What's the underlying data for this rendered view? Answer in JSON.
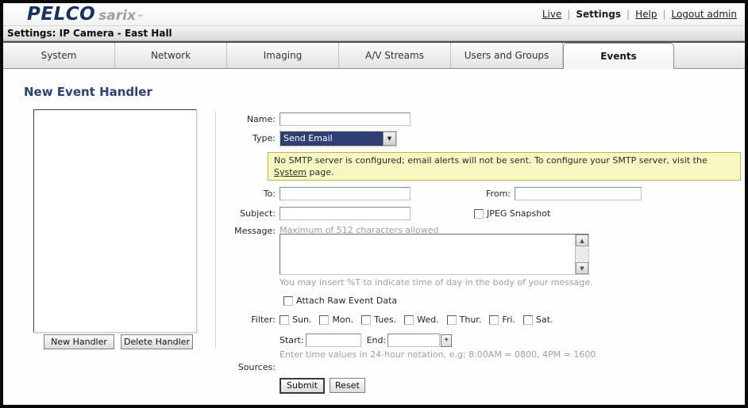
{
  "header": {
    "brand": "PELCO",
    "product": "sarix",
    "trademark": "™",
    "nav": {
      "live": "Live",
      "settings": "Settings",
      "help": "Help",
      "logout": "Logout admin",
      "separator": "|"
    }
  },
  "settings_bar": {
    "title": "Settings: IP Camera - East Hall"
  },
  "tabs": [
    {
      "label": "System"
    },
    {
      "label": "Network"
    },
    {
      "label": "Imaging"
    },
    {
      "label": "A/V Streams"
    },
    {
      "label": "Users and Groups"
    },
    {
      "label": "Events",
      "active": true
    }
  ],
  "content": {
    "title": "New Event Handler",
    "handler_panel": {
      "new_button": "New Handler",
      "delete_button": "Delete Handler"
    },
    "form": {
      "name_label": "Name:",
      "type_label": "Type:",
      "type_value": "Send Email",
      "dropdown_arrow": "▼",
      "warning": {
        "before": "No SMTP server is configured; email alerts will not be sent. To configure your SMTP server, visit the ",
        "link": "System",
        "after": " page."
      },
      "to_label": "To:",
      "from_label": "From:",
      "subject_label": "Subject:",
      "jpeg_label": "JPEG Snapshot",
      "message_label": "Message:",
      "message_hint": "Maximum of 512 characters allowed",
      "message_footnote": "You may insert %T to indicate time of day in the body of your message.",
      "scroll_up": "▲",
      "scroll_down": "▼",
      "attach_label": "Attach Raw Event Data",
      "filter_label": "Filter:",
      "days": [
        "Sun.",
        "Mon.",
        "Tues.",
        "Wed.",
        "Thur.",
        "Fri.",
        "Sat."
      ],
      "start_label": "Start:",
      "end_label": "End:",
      "add_button": "+",
      "time_hint": "Enter time values in 24-hour notation, e.g; 8:00AM = 0800, 4PM = 1600",
      "sources_label": "Sources:",
      "submit_button": "Submit",
      "reset_button": "Reset"
    }
  },
  "colors": {
    "accent_navy": "#2b4278",
    "selection_bg": "#2e3f74",
    "warning_bg": "#f7f7c2",
    "warning_border": "#c5b637",
    "frame": "#0a0a0a"
  }
}
